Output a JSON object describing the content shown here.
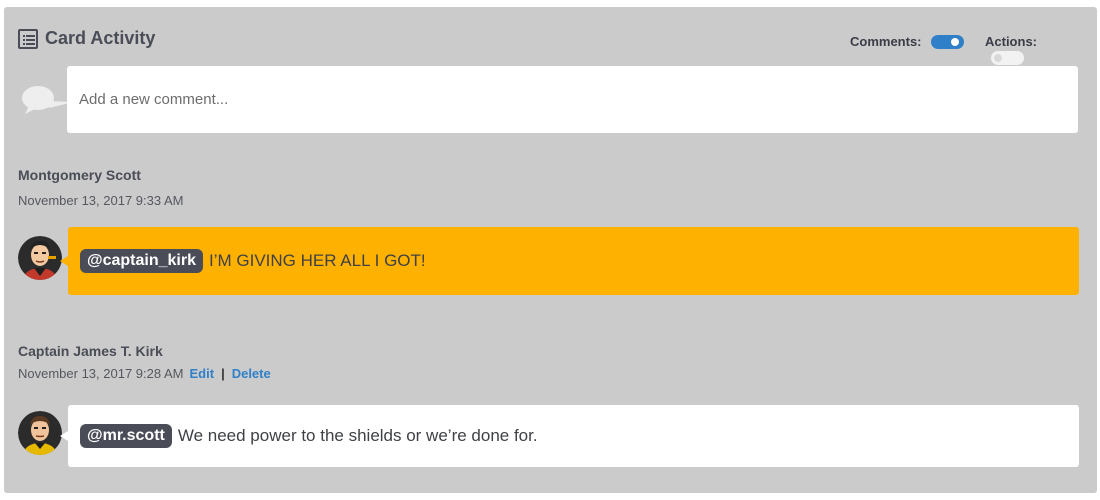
{
  "header": {
    "title": "Card Activity",
    "comments_label": "Comments:",
    "comments_enabled": true,
    "actions_label": "Actions:",
    "actions_enabled": false
  },
  "composer": {
    "placeholder": "Add a new comment..."
  },
  "comments": [
    {
      "author": "Montgomery Scott",
      "timestamp": "November 13, 2017 9:33 AM",
      "mention": "@captain_kirk",
      "text": "I’M GIVING HER ALL I GOT!",
      "highlight_color": "#ffb100"
    },
    {
      "author": "Captain James T. Kirk",
      "timestamp": "November 13, 2017 9:28 AM",
      "edit_label": "Edit",
      "separator": "|",
      "delete_label": "Delete",
      "mention": "@mr.scott",
      "text": "We need power to the shields or we’re done for."
    }
  ],
  "colors": {
    "panel": "#cbcbcb",
    "accent": "#2f80c8",
    "mention_bg": "#4a4d57"
  }
}
